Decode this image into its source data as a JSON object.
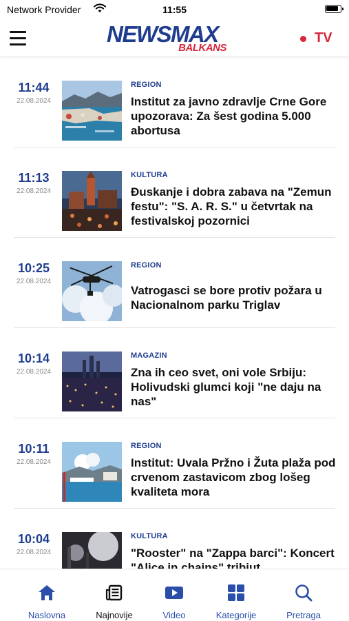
{
  "status_bar": {
    "carrier": "Network Provider",
    "time": "11:55",
    "battery_level": 0.9
  },
  "header": {
    "logo_main": "NEWSMAX",
    "logo_sub": "BALKANS",
    "tv_label": "TV"
  },
  "colors": {
    "brand_blue": "#1f3d8f",
    "brand_red": "#d7263d",
    "nav_blue": "#2b4ea8"
  },
  "articles": [
    {
      "time": "11:44",
      "date": "22.08.2024",
      "category": "REGION",
      "title": "Institut za javno zdravlje Crne Gore upozorava: Za šest godina 5.000 abortusa"
    },
    {
      "time": "11:13",
      "date": "22.08.2024",
      "category": "KULTURA",
      "title": "Đuskanje i dobra zabava na \"Zemun festu\": \"S. A. R. S.\" u četvrtak na festivalskoj pozornici"
    },
    {
      "time": "10:25",
      "date": "22.08.2024",
      "category": "REGION",
      "title": "Vatrogasci se bore protiv požara u Nacionalnom parku Triglav"
    },
    {
      "time": "10:14",
      "date": "22.08.2024",
      "category": "MAGAZIN",
      "title": "Zna ih ceo svet, oni vole Srbiju: Holivudski glumci koji \"ne daju na nas\""
    },
    {
      "time": "10:11",
      "date": "22.08.2024",
      "category": "REGION",
      "title": "Institut: Uvala Pržno i Žuta plaža pod crvenom zastavicom zbog lošeg kvaliteta mora"
    },
    {
      "time": "10:04",
      "date": "22.08.2024",
      "category": "KULTURA",
      "title": "\"Rooster\" na \"Zappa barci\": Koncert \"Alice in chains\" tribjut"
    }
  ],
  "bottom_nav": [
    {
      "label": "Naslovna",
      "icon": "home-icon"
    },
    {
      "label": "Najnovije",
      "icon": "newspaper-icon",
      "active": true
    },
    {
      "label": "Video",
      "icon": "video-icon"
    },
    {
      "label": "Kategorije",
      "icon": "grid-icon"
    },
    {
      "label": "Pretraga",
      "icon": "search-icon"
    }
  ]
}
